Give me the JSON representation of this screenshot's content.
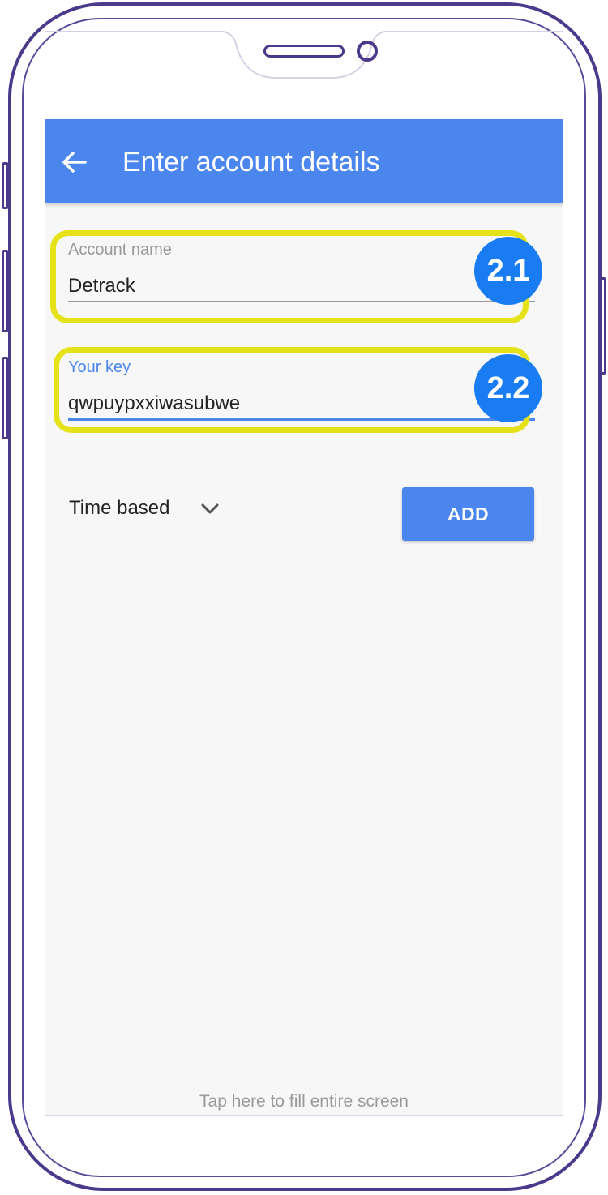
{
  "app_bar": {
    "title": "Enter account details",
    "back_icon": "arrow-left-icon",
    "color": "#4a86ee"
  },
  "fields": {
    "account_name": {
      "label": "Account name",
      "value": "Detrack"
    },
    "your_key": {
      "label": "Your key",
      "value": "qwpuypxxiwasubwe"
    }
  },
  "annotations": {
    "badge_1": "2.1",
    "badge_2": "2.2",
    "highlight_color": "#e6e21a",
    "badge_color": "#1a7cf3"
  },
  "key_type": {
    "selected": "Time based",
    "icon": "chevron-down-icon"
  },
  "add_button": {
    "label": "ADD"
  },
  "footer_hint": "Tap here to fill entire screen",
  "frame_color": "#4b3a8c"
}
